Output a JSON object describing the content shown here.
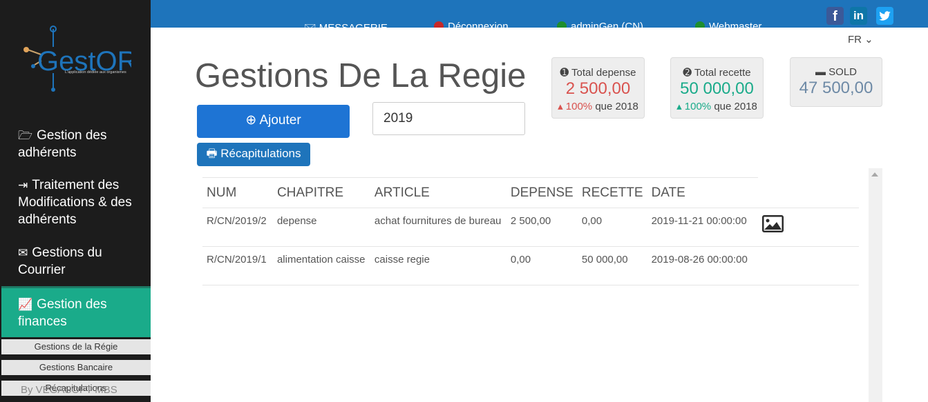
{
  "logo": {
    "name": "GestORG",
    "tagline": "L'application dédiée aux organismes"
  },
  "sidebar": {
    "items": [
      {
        "label": "Gestion des adhérents",
        "icon": "folder-open-icon"
      },
      {
        "label": "Traitement des Modifications & des adhérents",
        "icon": "sign-in-icon"
      },
      {
        "label": "Gestions du Courrier",
        "icon": "mail-bulk-icon"
      },
      {
        "label": "Gestion des finances",
        "icon": "line-chart-icon",
        "active": true
      }
    ],
    "subitems": [
      "Gestions de la Régie",
      "Gestions Bancaire",
      "Récapitulations"
    ],
    "footer": "By VEGASOFT MBS",
    "active_color": "#1aab8a"
  },
  "topbar": {
    "color": "#1e74bb",
    "links": [
      {
        "label": "MESSAGERIE",
        "icon": "envelope-icon"
      },
      {
        "label": "Déconnexion",
        "status_color": "#c62828"
      },
      {
        "label": "adminGen (CN)",
        "status_color": "#1e8e2e"
      },
      {
        "label": "Webmaster",
        "status_color": "#1e8e2e"
      }
    ],
    "social": [
      "f",
      "in",
      "twitter-bird"
    ],
    "language": "FR"
  },
  "main": {
    "title": "Gestions De La Regie",
    "add_label": "Ajouter",
    "recap_label": "Récapitulations",
    "year": "2019"
  },
  "cards": {
    "depense": {
      "label": "Total depense",
      "value": "2 500,00",
      "pct": "100%",
      "cmp": "que 2018"
    },
    "recette": {
      "label": "Total recette",
      "value": "50 000,00",
      "pct": "100%",
      "cmp": "que 2018"
    },
    "sold": {
      "label": "SOLD",
      "value": "47 500,00"
    }
  },
  "table": {
    "headers": [
      "NUM",
      "CHAPITRE",
      "ARTICLE",
      "DEPENSE",
      "RECETTE",
      "DATE"
    ],
    "rows": [
      {
        "num": "R/CN/2019/2",
        "chapitre": "depense",
        "article": "achat fournitures de bureau",
        "depense": "2 500,00",
        "recette": "0,00",
        "date": "2019-11-21 00:00:00",
        "has_image": true
      },
      {
        "num": "R/CN/2019/1",
        "chapitre": "alimentation caisse",
        "article": "caisse regie",
        "depense": "0,00",
        "recette": "50 000,00",
        "date": "2019-08-26 00:00:00",
        "has_image": false
      }
    ]
  }
}
